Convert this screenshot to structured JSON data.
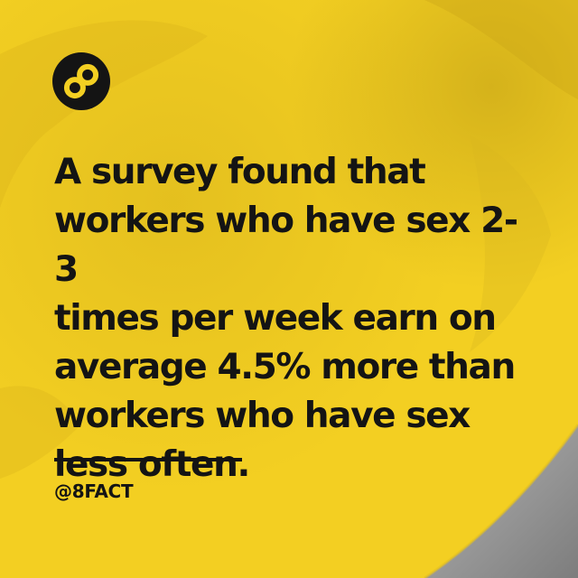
{
  "post": {
    "headline": "A survey found that\nworkers who have sex 2-3\ntimes per week earn on\naverage 4.5% more than\nworkers who have sex\nless often.",
    "handle": "@8FACT"
  },
  "brand": {
    "logo_icon": "infinity-eight-icon",
    "accent_color": "#f3cf22",
    "text_color": "#141414",
    "corner_color": "#9a9a9a"
  }
}
